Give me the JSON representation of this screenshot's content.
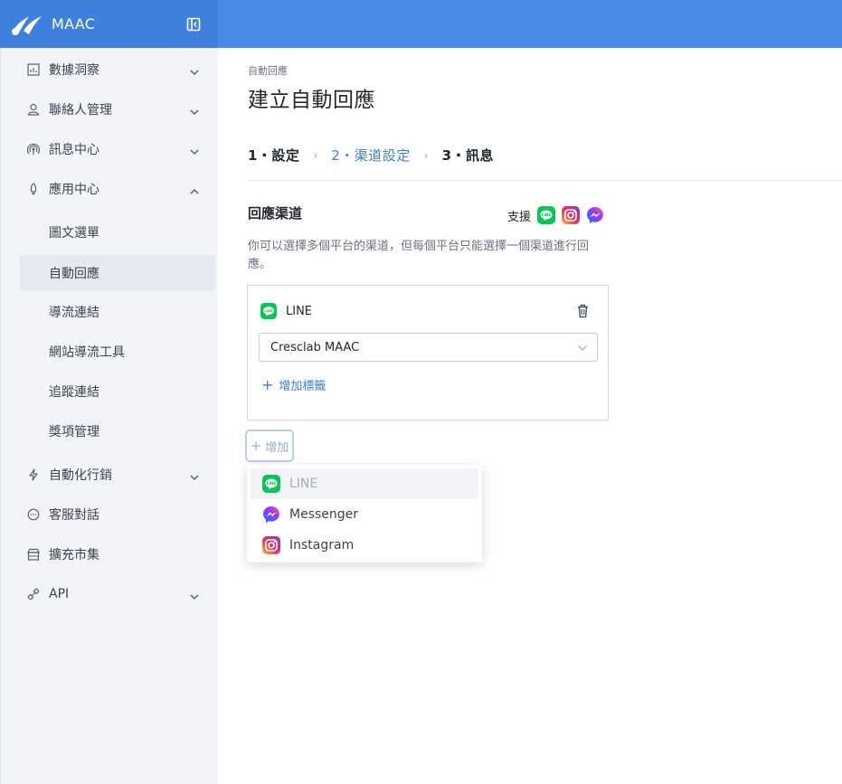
{
  "app": {
    "name": "MAAC"
  },
  "sidebar": {
    "items": [
      {
        "label": "數據洞察",
        "icon": "chart-icon",
        "expandable": true
      },
      {
        "label": "聯絡人管理",
        "icon": "person-icon",
        "expandable": true
      },
      {
        "label": "訊息中心",
        "icon": "broadcast-icon",
        "expandable": true
      },
      {
        "label": "應用中心",
        "icon": "rocket-icon",
        "expandable": true,
        "expanded": true
      },
      {
        "label": "自動化行銷",
        "icon": "lightning-icon",
        "expandable": true
      },
      {
        "label": "客服對話",
        "icon": "chat-icon",
        "expandable": false
      },
      {
        "label": "擴充市集",
        "icon": "store-icon",
        "expandable": false
      },
      {
        "label": "API",
        "icon": "api-icon",
        "expandable": true
      }
    ],
    "app_center_sub": [
      {
        "label": "圖文選單"
      },
      {
        "label": "自動回應",
        "active": true
      },
      {
        "label": "導流連結"
      },
      {
        "label": "網站導流工具"
      },
      {
        "label": "追蹤連結"
      },
      {
        "label": "獎項管理"
      }
    ]
  },
  "main": {
    "breadcrumb": "自動回應",
    "title": "建立自動回應",
    "steps": [
      {
        "label": "1・設定"
      },
      {
        "label": "2・渠道設定",
        "current": true
      },
      {
        "label": "3・訊息"
      }
    ],
    "step_separator": "›",
    "section_title": "回應渠道",
    "support_label": "支援",
    "description": "你可以選擇多個平台的渠道，但每個平台只能選擇一個渠道進行回應。",
    "channel_card": {
      "platform": "LINE",
      "selected_channel": "Cresclab MAAC",
      "add_tag_label": "增加標籤"
    },
    "add_button": "增加",
    "dropdown": [
      {
        "label": "LINE",
        "disabled": true,
        "icon": "line-icon"
      },
      {
        "label": "Messenger",
        "disabled": false,
        "icon": "messenger-icon"
      },
      {
        "label": "Instagram",
        "disabled": false,
        "icon": "instagram-icon"
      }
    ]
  },
  "colors": {
    "topbar": "#4a8ae8",
    "accent": "#3e7ddb",
    "line_green": "#06c755",
    "sidebar_bg": "#f3f4f7"
  }
}
